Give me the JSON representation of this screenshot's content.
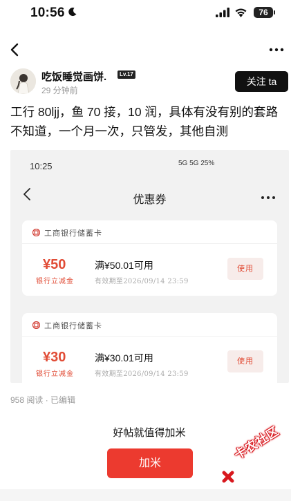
{
  "status_bar": {
    "time": "10:56",
    "battery": "76"
  },
  "author": {
    "name": "吃饭睡觉画饼.",
    "level": "Lv.17",
    "time_ago": "29 分钟前",
    "follow_label": "关注 ta"
  },
  "post": {
    "text": "工行 80ljj，鱼 70 接，10 润，具体有没有别的套路不知道，一个月一次，只管发，其他自测"
  },
  "screenshot": {
    "time": "10:25",
    "status": "5G 5G  25%",
    "title": "优惠券",
    "coupons": [
      {
        "bank": "工商银行储蓄卡",
        "amount": "¥50",
        "sub": "银行立减金",
        "condition": "满¥50.01可用",
        "validity": "有效期至2026/09/14  23:59",
        "use_label": "使用"
      },
      {
        "bank": "工商银行储蓄卡",
        "amount": "¥30",
        "sub": "银行立减金",
        "condition": "满¥30.01可用",
        "validity": "有效期至2026/09/14  23:59",
        "use_label": "使用"
      }
    ]
  },
  "footer": {
    "meta": "958 阅读 · 已编辑",
    "prompt": "好帖就值得加米",
    "jiami_label": "加米",
    "watermark": "卡农社区"
  },
  "colors": {
    "accent": "#ec3a2f",
    "coupon_red": "#e14c36",
    "follow_bg": "#111111"
  }
}
